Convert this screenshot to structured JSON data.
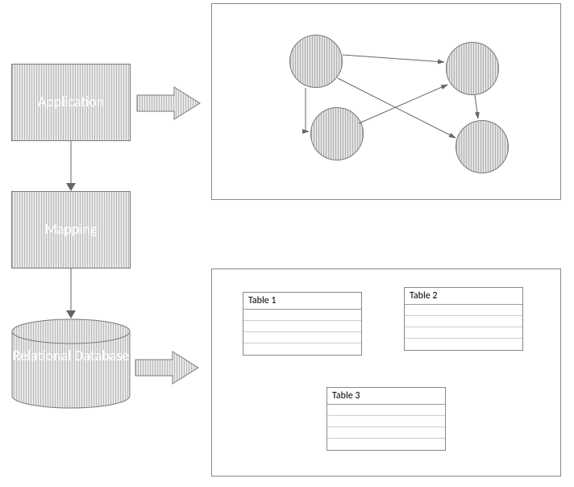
{
  "boxes": {
    "application": "Application",
    "mapping": "Mapping",
    "database": "Relational Database"
  },
  "tables": {
    "t1": "Table 1",
    "t2": "Table 2",
    "t3": "Table 3"
  }
}
